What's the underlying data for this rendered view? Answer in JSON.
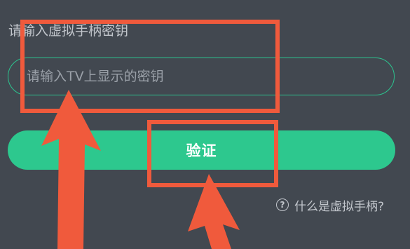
{
  "form": {
    "prompt_label": "请输入虚拟手柄密钥",
    "key_input_placeholder": "请输入TV上显示的密钥",
    "key_input_value": "",
    "verify_button_label": "验证",
    "help_link_label": "什么是虚拟手柄?",
    "help_icon_glyph": "?"
  },
  "icons": {
    "help": "question-circle-icon"
  },
  "colors": {
    "background": "#424850",
    "accent": "#2dc88e",
    "input_border": "#2cc48f",
    "annotation": "#f05a3c"
  }
}
